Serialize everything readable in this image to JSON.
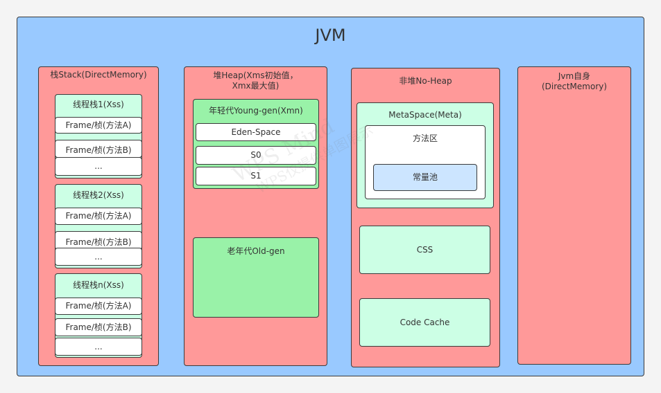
{
  "jvm": {
    "title": "JVM"
  },
  "stack": {
    "title": "栈Stack(DirectMemory)",
    "threads": [
      {
        "title": "线程栈1(Xss)",
        "frames": [
          "Frame/桢(方法A)",
          "Frame/桢(方法B)",
          "..."
        ]
      },
      {
        "title": "线程栈2(Xss)",
        "frames": [
          "Frame/桢(方法A)",
          "Frame/桢(方法B)",
          "..."
        ]
      },
      {
        "title": "线程栈n(Xss)",
        "frames": [
          "Frame/桢(方法A)",
          "Frame/桢(方法B)",
          "..."
        ]
      }
    ]
  },
  "heap": {
    "title": "堆Heap(Xms初始值，Xmx最大值)",
    "young": {
      "title": "年轻代Young-gen(Xmn)",
      "spaces": [
        "Eden-Space",
        "S0",
        "S1"
      ]
    },
    "old": {
      "title": "老年代Old-gen"
    }
  },
  "nonheap": {
    "title": "非堆No-Heap",
    "metaspace": {
      "title": "MetaSpace(Meta)",
      "method_area": {
        "title": "方法区",
        "constant_pool": "常量池"
      }
    },
    "css": "CSS",
    "code_cache": "Code Cache"
  },
  "self": {
    "title": "Jvm自身(DirectMemory)"
  },
  "watermark": {
    "line1": "WPS Mind",
    "line2": "WPS仅提供单图展示"
  },
  "colors": {
    "jvm": "#99c9ff",
    "red": "#ff9999",
    "green": "#99f2a8",
    "mint": "#ccffe5",
    "white": "#ffffff",
    "blue": "#cce5ff"
  }
}
